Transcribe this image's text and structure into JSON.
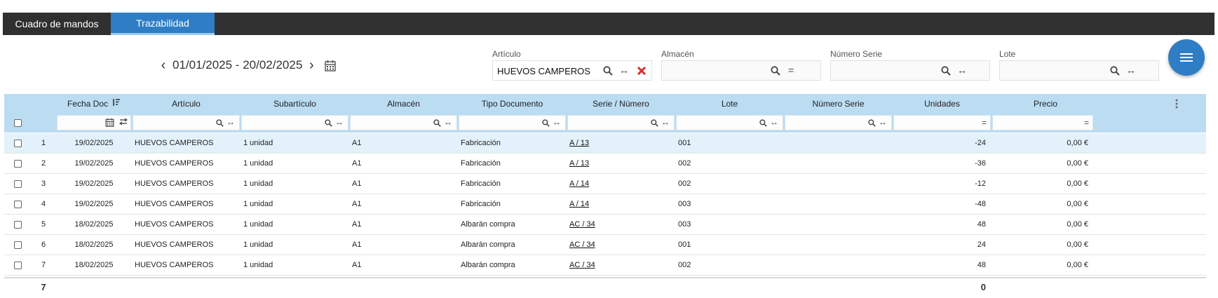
{
  "tabs": [
    {
      "label": "Cuadro de mandos",
      "active": false
    },
    {
      "label": "Trazabilidad",
      "active": true
    }
  ],
  "date_range": {
    "label": "01/01/2025 - 20/02/2025"
  },
  "filters": {
    "articulo": {
      "label": "Artículo",
      "value": "HUEVOS CAMPEROS",
      "op": "↔"
    },
    "almacen": {
      "label": "Almacén",
      "value": "",
      "op": "="
    },
    "numero_serie": {
      "label": "Número Serie",
      "value": "",
      "op": "↔"
    },
    "lote": {
      "label": "Lote",
      "value": "",
      "op": "↔"
    }
  },
  "table": {
    "columns": [
      "Fecha Doc",
      "Artículo",
      "Subartículo",
      "Almacén",
      "Tipo Documento",
      "Serie / Número",
      "Lote",
      "Número Serie",
      "Unidades",
      "Precio"
    ],
    "filter_ops": {
      "contains": "↔",
      "equals": "="
    },
    "rows": [
      {
        "n": "1",
        "fecha": "19/02/2025",
        "articulo": "HUEVOS CAMPEROS",
        "subarticulo": "1 unidad",
        "almacen": "A1",
        "tipo": "Fabricación",
        "serie": "A / 13",
        "lote": "001",
        "numserie": "",
        "unidades": "-24",
        "precio": "0,00 €"
      },
      {
        "n": "2",
        "fecha": "19/02/2025",
        "articulo": "HUEVOS CAMPEROS",
        "subarticulo": "1 unidad",
        "almacen": "A1",
        "tipo": "Fabricación",
        "serie": "A / 13",
        "lote": "002",
        "numserie": "",
        "unidades": "-36",
        "precio": "0,00 €"
      },
      {
        "n": "3",
        "fecha": "19/02/2025",
        "articulo": "HUEVOS CAMPEROS",
        "subarticulo": "1 unidad",
        "almacen": "A1",
        "tipo": "Fabricación",
        "serie": "A / 14",
        "lote": "002",
        "numserie": "",
        "unidades": "-12",
        "precio": "0,00 €"
      },
      {
        "n": "4",
        "fecha": "19/02/2025",
        "articulo": "HUEVOS CAMPEROS",
        "subarticulo": "1 unidad",
        "almacen": "A1",
        "tipo": "Fabricación",
        "serie": "A / 14",
        "lote": "003",
        "numserie": "",
        "unidades": "-48",
        "precio": "0,00 €"
      },
      {
        "n": "5",
        "fecha": "18/02/2025",
        "articulo": "HUEVOS CAMPEROS",
        "subarticulo": "1 unidad",
        "almacen": "A1",
        "tipo": "Albarán compra",
        "serie": "AC / 34",
        "lote": "003",
        "numserie": "",
        "unidades": "48",
        "precio": "0,00 €"
      },
      {
        "n": "6",
        "fecha": "18/02/2025",
        "articulo": "HUEVOS CAMPEROS",
        "subarticulo": "1 unidad",
        "almacen": "A1",
        "tipo": "Albarán compra",
        "serie": "AC / 34",
        "lote": "001",
        "numserie": "",
        "unidades": "24",
        "precio": "0,00 €"
      },
      {
        "n": "7",
        "fecha": "18/02/2025",
        "articulo": "HUEVOS CAMPEROS",
        "subarticulo": "1 unidad",
        "almacen": "A1",
        "tipo": "Albarán compra",
        "serie": "AC / 34",
        "lote": "002",
        "numserie": "",
        "unidades": "48",
        "precio": "0,00 €"
      }
    ],
    "footer": {
      "count": "7",
      "unidades_total": "0"
    }
  },
  "colors": {
    "accent": "#2f7dc4",
    "header_bg": "#bcdcf2",
    "tabbar_bg": "#303030",
    "selected_row": "#e3f1fb",
    "clear_icon": "#d32f2f"
  }
}
